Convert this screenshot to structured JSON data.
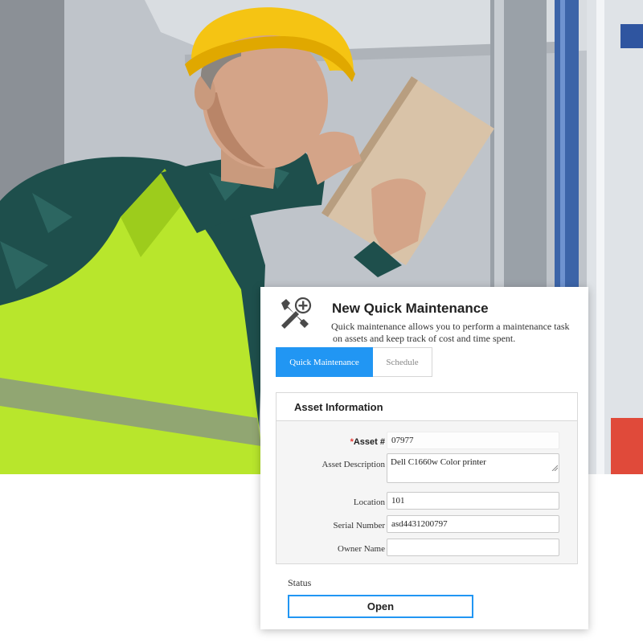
{
  "photo": {
    "subject": "worker-with-tablet"
  },
  "card": {
    "title": "New Quick Maintenance",
    "description_line1": "Quick maintenance allows you to perform a maintenance task",
    "description_line2": "on assets and keep track of cost and time spent.",
    "tabs": [
      {
        "label": "Quick Maintenance",
        "active": true
      },
      {
        "label": "Schedule",
        "active": false
      }
    ],
    "asset_panel": {
      "title": "Asset Information",
      "fields": {
        "asset_number": {
          "required_mark": "*",
          "label": "Asset #",
          "value": "07977"
        },
        "asset_description": {
          "label": "Asset Description",
          "value": "Dell C1660w Color printer"
        },
        "location": {
          "label": "Location",
          "value": "101"
        },
        "serial_number": {
          "label": "Serial Number",
          "value": "asd4431200797"
        },
        "owner_name": {
          "label": "Owner Name",
          "value": ""
        }
      }
    },
    "status": {
      "label": "Status",
      "value": "Open"
    }
  },
  "colors": {
    "accent": "#2196f3",
    "required": "#e53935",
    "vest": "#b8e62c"
  }
}
